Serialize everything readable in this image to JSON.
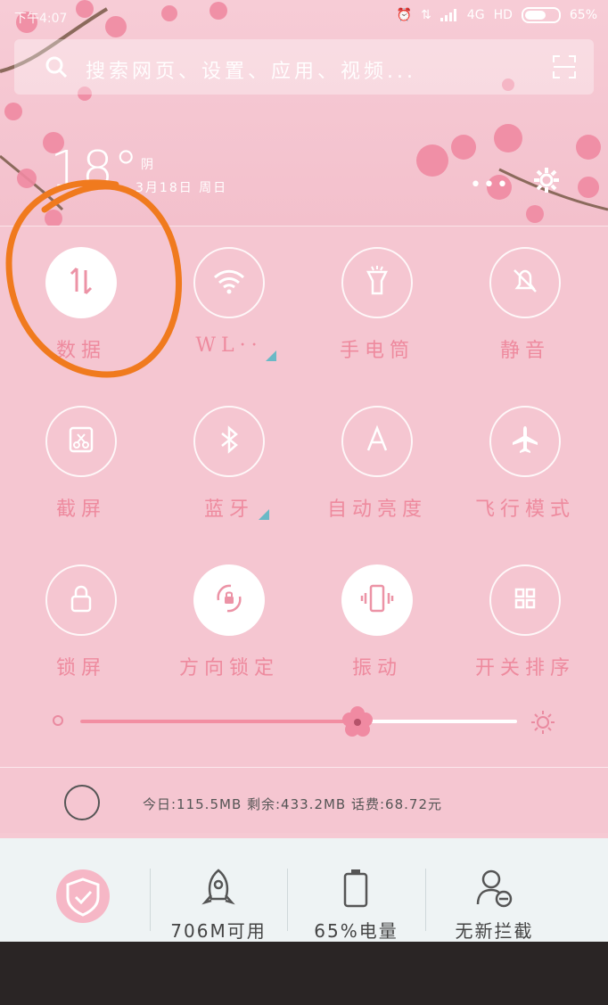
{
  "status": {
    "time": "下午4:07",
    "network": "4G",
    "hd": "HD",
    "battery_text": "65%",
    "battery_level": 0.65
  },
  "search": {
    "placeholder": "搜索网页、设置、应用、视频..."
  },
  "weather": {
    "temperature": "18°",
    "condition": "阴",
    "date": "3月18日 周日"
  },
  "toggles": [
    {
      "label": "数据",
      "icon": "data-transfer-icon",
      "on": true
    },
    {
      "label": "WL··",
      "icon": "wifi-icon",
      "on": false
    },
    {
      "label": "手电筒",
      "icon": "flashlight-icon",
      "on": false
    },
    {
      "label": "静音",
      "icon": "bell-mute-icon",
      "on": false
    },
    {
      "label": "截屏",
      "icon": "screenshot-icon",
      "on": false
    },
    {
      "label": "蓝牙",
      "icon": "bluetooth-icon",
      "on": false
    },
    {
      "label": "自动亮度",
      "icon": "auto-brightness-icon",
      "on": false
    },
    {
      "label": "飞行模式",
      "icon": "airplane-icon",
      "on": false
    },
    {
      "label": "锁屏",
      "icon": "lock-icon",
      "on": false
    },
    {
      "label": "方向锁定",
      "icon": "rotation-lock-icon",
      "on": true
    },
    {
      "label": "振动",
      "icon": "vibrate-icon",
      "on": true
    },
    {
      "label": "开关排序",
      "icon": "grid-icon",
      "on": false
    }
  ],
  "brightness": {
    "level": 0.635
  },
  "usage": {
    "text": "今日:115.5MB  剩余:433.2MB  话费:68.72元"
  },
  "card": {
    "memory": "706M可用",
    "battery": "65%电量",
    "intercept": "无新拦截"
  },
  "colors": {
    "accent": "#ee8a9e",
    "annotation": "#f07a1e"
  }
}
